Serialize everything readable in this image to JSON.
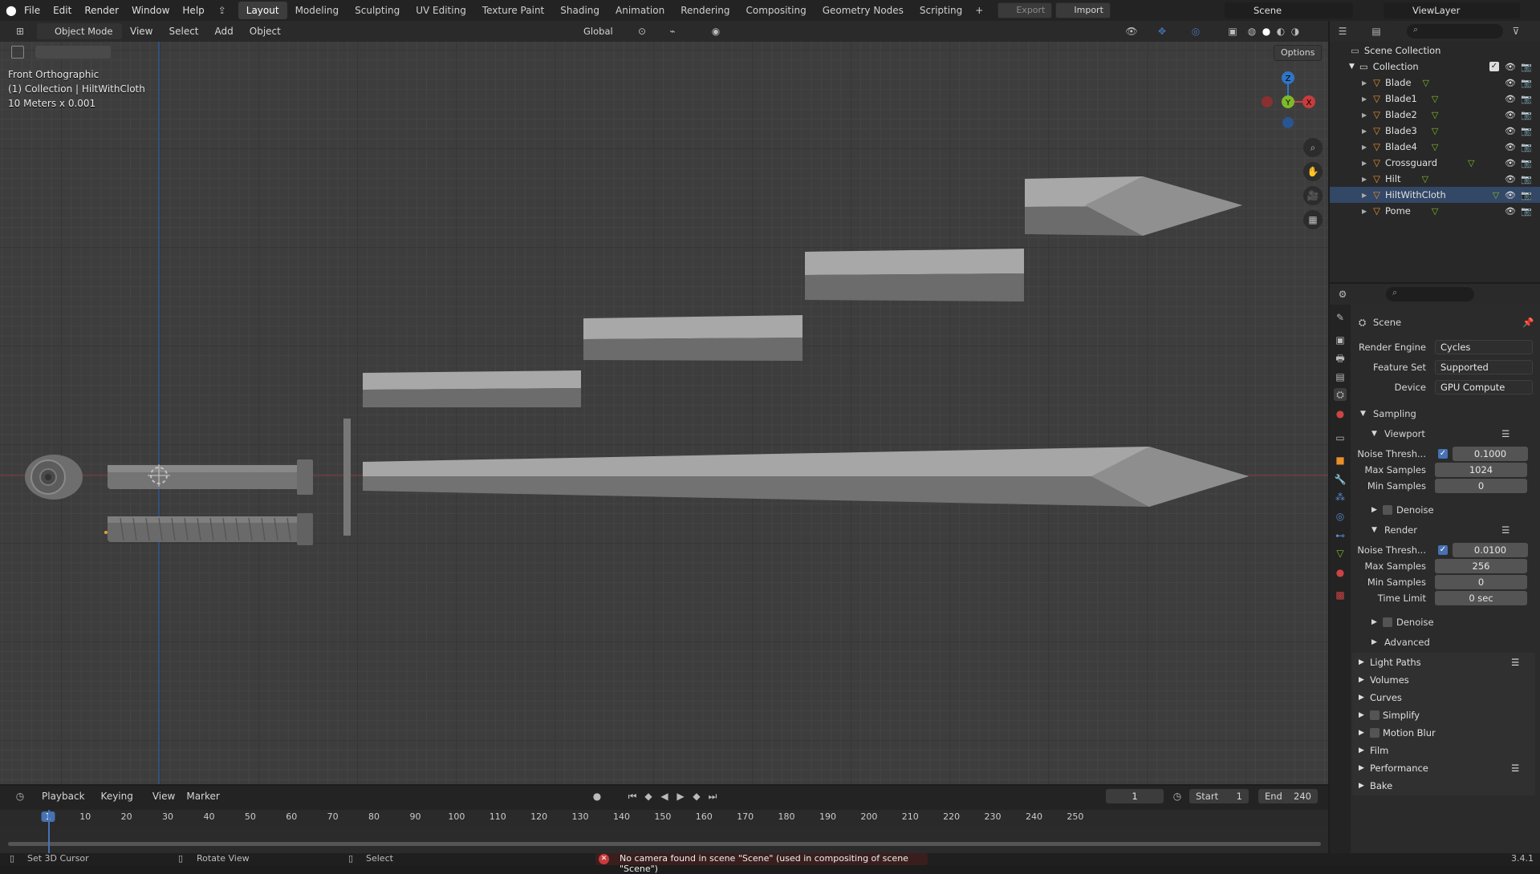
{
  "topbar": {
    "menus": [
      "File",
      "Edit",
      "Render",
      "Window",
      "Help"
    ],
    "workspaces": [
      "Layout",
      "Modeling",
      "Sculpting",
      "UV Editing",
      "Texture Paint",
      "Shading",
      "Animation",
      "Rendering",
      "Compositing",
      "Geometry Nodes",
      "Scripting"
    ],
    "active_workspace": "Layout",
    "export_label": "Export",
    "import_label": "Import",
    "scene_name": "Scene",
    "view_layer": "ViewLayer"
  },
  "viewport_header": {
    "mode": "Object Mode",
    "menus": [
      "View",
      "Select",
      "Add",
      "Object"
    ],
    "orientation": "Global",
    "options_label": "Options"
  },
  "viewport": {
    "view_name": "Front Orthographic",
    "collection_info": "(1) Collection | HiltWithCloth",
    "scale_info": "10 Meters x 0.001",
    "gizmo": {
      "z": "Z",
      "y": "Y",
      "x": "X"
    }
  },
  "outliner": {
    "root": "Scene Collection",
    "collection": "Collection",
    "objects": [
      "Blade",
      "Blade1",
      "Blade2",
      "Blade3",
      "Blade4",
      "Crossguard",
      "Hilt",
      "HiltWithCloth",
      "Pome"
    ]
  },
  "properties": {
    "context": "Scene",
    "render_engine_label": "Render Engine",
    "render_engine": "Cycles",
    "feature_set_label": "Feature Set",
    "feature_set": "Supported",
    "device_label": "Device",
    "device": "GPU Compute",
    "sampling": "Sampling",
    "viewport_section": "Viewport",
    "vp_noise_label": "Noise Thresh...",
    "vp_noise": "0.1000",
    "vp_max_label": "Max Samples",
    "vp_max": "1024",
    "vp_min_label": "Min Samples",
    "vp_min": "0",
    "denoise": "Denoise",
    "render_section": "Render",
    "r_noise_label": "Noise Thresh...",
    "r_noise": "0.0100",
    "r_max_label": "Max Samples",
    "r_max": "256",
    "r_min_label": "Min Samples",
    "r_min": "0",
    "r_time_label": "Time Limit",
    "r_time": "0 sec",
    "advanced": "Advanced",
    "panels": [
      "Light Paths",
      "Volumes",
      "Curves",
      "Simplify",
      "Motion Blur",
      "Film",
      "Performance",
      "Bake"
    ]
  },
  "timeline": {
    "menus": [
      "Playback",
      "Keying",
      "View",
      "Marker"
    ],
    "current_frame": "1",
    "start_label": "Start",
    "start": "1",
    "end_label": "End",
    "end": "240",
    "ticks": [
      "1",
      "10",
      "20",
      "30",
      "40",
      "50",
      "60",
      "70",
      "80",
      "90",
      "100",
      "110",
      "120",
      "130",
      "140",
      "150",
      "160",
      "170",
      "180",
      "190",
      "200",
      "210",
      "220",
      "230",
      "240",
      "250"
    ]
  },
  "statusbar": {
    "left1": "Set 3D Cursor",
    "left2": "Rotate View",
    "left3": "Select",
    "error": "No camera found in scene \"Scene\" (used in compositing of scene \"Scene\")",
    "version": "3.4.1"
  },
  "colors": {
    "accent": "#4772b3",
    "axis_x": "#c83c3c",
    "axis_y": "#7fb82a",
    "axis_z": "#2f75c8",
    "error": "#c83c3c"
  }
}
